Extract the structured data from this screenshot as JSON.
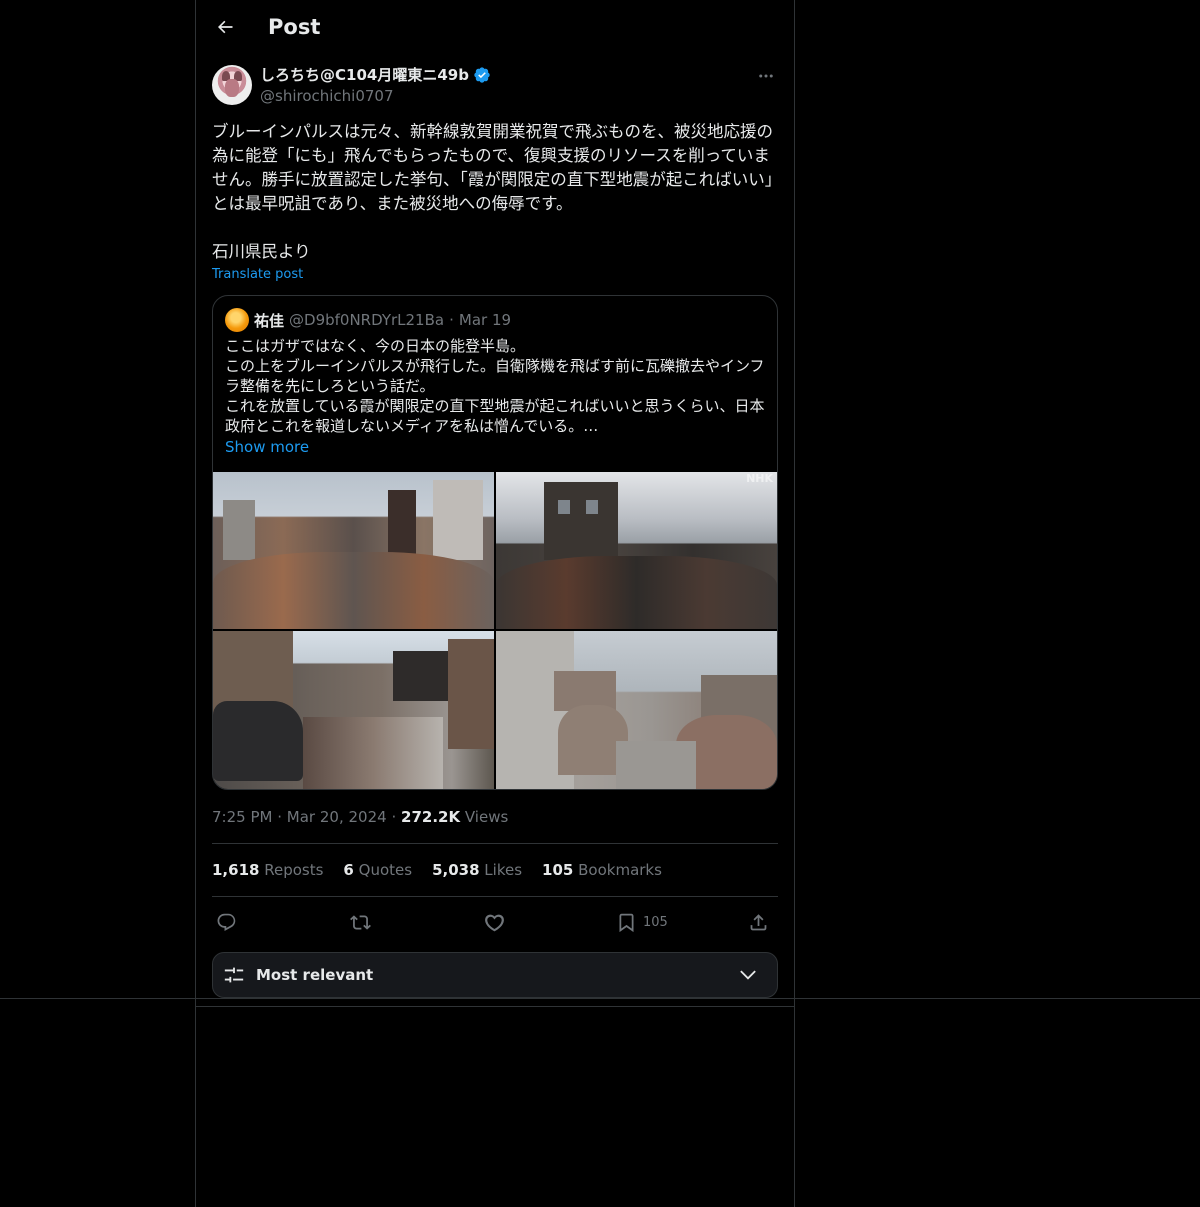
{
  "header": {
    "title": "Post"
  },
  "author": {
    "display_name": "しろちち@C104月曜東ニ49b",
    "handle": "@shirochichi0707"
  },
  "post": {
    "text": "ブルーインパルスは元々、新幹線敦賀開業祝賀で飛ぶものを、被災地応援の為に能登「にも」飛んでもらったもので、復興支援のリソースを削っていません。勝手に放置認定した挙句、「霞が関限定の直下型地震が起こればいい」とは最早呪詛であり、また被災地への侮辱です。\n\n石川県民より",
    "translate_label": "Translate post"
  },
  "quote": {
    "name": "祐佳",
    "handle": "@D9bf0NRDYrL21Ba",
    "separator": "·",
    "date": "Mar 19",
    "text": "ここはガザではなく、今の日本の能登半島。\nこの上をブルーインパルスが飛行した。自衛隊機を飛ばす前に瓦礫撤去やインフラ整備を先にしろという話だ。\nこれを放置している霞が関限定の直下型地震が起こればいいと思うくらい、日本政府とこれを報道しないメディアを私は憎んでいる。…",
    "show_more": "Show more",
    "image_watermark": "NHK"
  },
  "meta": {
    "time": "7:25 PM",
    "sep1": "·",
    "date": "Mar 20, 2024",
    "sep2": "·",
    "views_count": "272.2K",
    "views_label": "Views"
  },
  "stats": {
    "reposts_count": "1,618",
    "reposts_label": "Reposts",
    "quotes_count": "6",
    "quotes_label": "Quotes",
    "likes_count": "5,038",
    "likes_label": "Likes",
    "bookmarks_count": "105",
    "bookmarks_label": "Bookmarks"
  },
  "actions": {
    "bookmark_count": "105"
  },
  "sort": {
    "label": "Most relevant"
  },
  "colors": {
    "accent": "#1d9bf0",
    "background": "#000000",
    "border": "#2f3336",
    "muted": "#71767b"
  }
}
